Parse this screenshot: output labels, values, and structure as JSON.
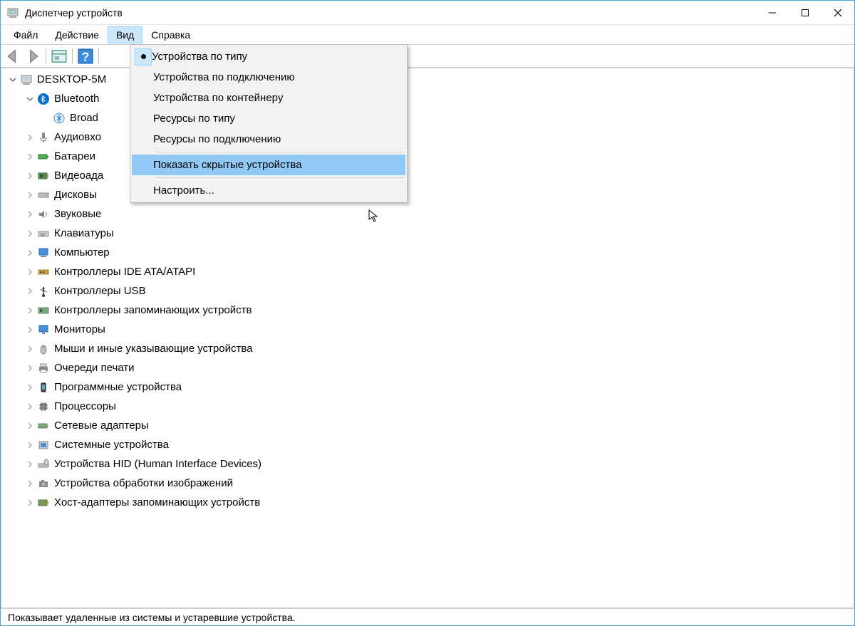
{
  "window": {
    "title": "Диспетчер устройств"
  },
  "menubar": {
    "file": "Файл",
    "action": "Действие",
    "view": "Вид",
    "help": "Справка"
  },
  "dropdown": {
    "devices_by_type": "Устройства по типу",
    "devices_by_connection": "Устройства по подключению",
    "devices_by_container": "Устройства по контейнеру",
    "resources_by_type": "Ресурсы по типу",
    "resources_by_connection": "Ресурсы по подключению",
    "show_hidden": "Показать скрытые устройства",
    "customize": "Настроить..."
  },
  "tree": {
    "root": "DESKTOP-5M",
    "bluetooth": "Bluetooth",
    "bluetooth_child": "Broad",
    "audio_inputs": "Аудиовхо",
    "batteries": "Батареи",
    "display_adapters": "Видеоада",
    "disk_drives": "Дисковы",
    "sound_devices": "Звуковые",
    "keyboards": "Клавиатуры",
    "computer": "Компьютер",
    "ide_controllers": "Контроллеры IDE ATA/ATAPI",
    "usb_controllers": "Контроллеры USB",
    "storage_controllers": "Контроллеры запоминающих устройств",
    "monitors": "Мониторы",
    "mice": "Мыши и иные указывающие устройства",
    "print_queues": "Очереди печати",
    "software_devices": "Программные устройства",
    "processors": "Процессоры",
    "network_adapters": "Сетевые адаптеры",
    "system_devices": "Системные устройства",
    "hid": "Устройства HID (Human Interface Devices)",
    "imaging": "Устройства обработки изображений",
    "host_adapters": "Хост-адаптеры запоминающих устройств"
  },
  "statusbar": {
    "text": "Показывает удаленные из системы и устаревшие устройства."
  }
}
